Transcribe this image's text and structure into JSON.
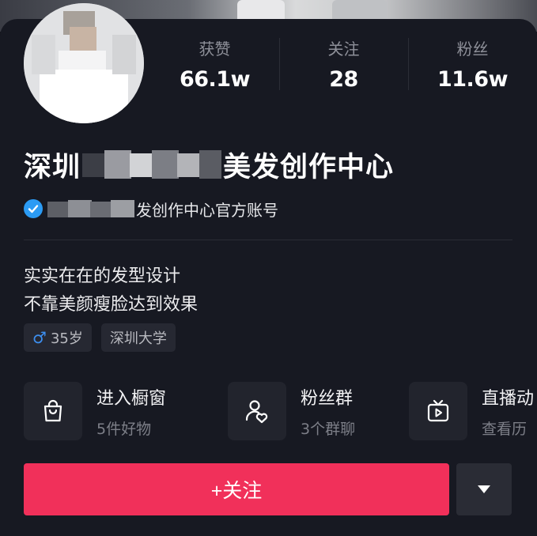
{
  "stats": [
    {
      "label": "获赞",
      "value": "66.1w"
    },
    {
      "label": "关注",
      "value": "28"
    },
    {
      "label": "粉丝",
      "value": "11.6w"
    }
  ],
  "profile": {
    "name_prefix": "深圳",
    "name_suffix": "美发创作中心",
    "verify_text": "发创作中心官方账号",
    "bio_line1": "实实在在的发型设计",
    "bio_line2": "不靠美颜瘦脸达到效果"
  },
  "tags": {
    "age": "35岁",
    "age_symbol": "♂",
    "school": "深圳大学"
  },
  "entries": [
    {
      "title": "进入橱窗",
      "sub": "5件好物",
      "icon": "shopping-bag-icon"
    },
    {
      "title": "粉丝群",
      "sub": "3个群聊",
      "icon": "group-chat-icon"
    },
    {
      "title": "直播动",
      "sub": "查看历",
      "icon": "tv-play-icon"
    }
  ],
  "actions": {
    "follow": "+关注"
  },
  "colors": {
    "accent": "#f1305a",
    "verify": "#2b9bf4",
    "background": "#171922"
  }
}
